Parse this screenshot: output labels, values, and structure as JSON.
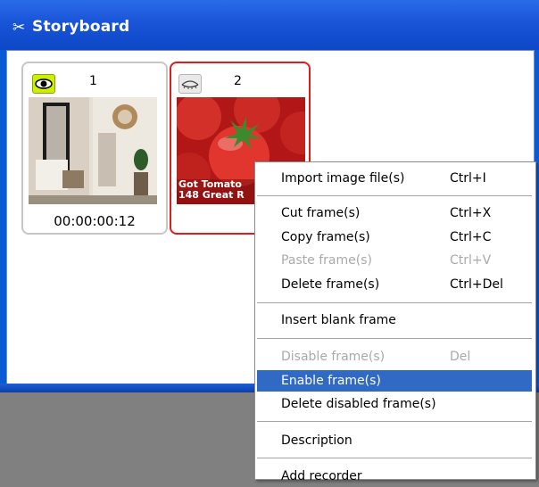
{
  "window": {
    "title": "Storyboard",
    "title_icon": "storyboard-scissors-icon"
  },
  "frames": [
    {
      "number": "1",
      "timecode": "00:00:00:12",
      "visible": true,
      "selected": false
    },
    {
      "number": "2",
      "timecode": "",
      "visible": false,
      "selected": true,
      "caption": "Got Tomato\n148 Great R"
    }
  ],
  "context_menu": {
    "items": [
      {
        "label": "Import image file(s)",
        "shortcut": "Ctrl+I",
        "enabled": true
      },
      {
        "label": "Cut frame(s)",
        "shortcut": "Ctrl+X",
        "enabled": true
      },
      {
        "label": "Copy frame(s)",
        "shortcut": "Ctrl+C",
        "enabled": true
      },
      {
        "label": "Paste frame(s)",
        "shortcut": "Ctrl+V",
        "enabled": false
      },
      {
        "label": "Delete frame(s)",
        "shortcut": "Ctrl+Del",
        "enabled": true
      },
      {
        "label": "Insert blank frame",
        "shortcut": "",
        "enabled": true
      },
      {
        "label": "Disable frame(s)",
        "shortcut": "Del",
        "enabled": false
      },
      {
        "label": "Enable frame(s)",
        "shortcut": "",
        "enabled": true,
        "highlighted": true
      },
      {
        "label": "Delete disabled frame(s)",
        "shortcut": "",
        "enabled": true
      },
      {
        "label": "Description",
        "shortcut": "",
        "enabled": true
      },
      {
        "label": "Add recorder",
        "shortcut": "",
        "enabled": true
      }
    ]
  },
  "colors": {
    "title_bar": "#1a56d9",
    "selected_frame_border": "#e01b1b",
    "visible_eye_bg": "#ccf000",
    "menu_highlight": "#316ac5"
  }
}
